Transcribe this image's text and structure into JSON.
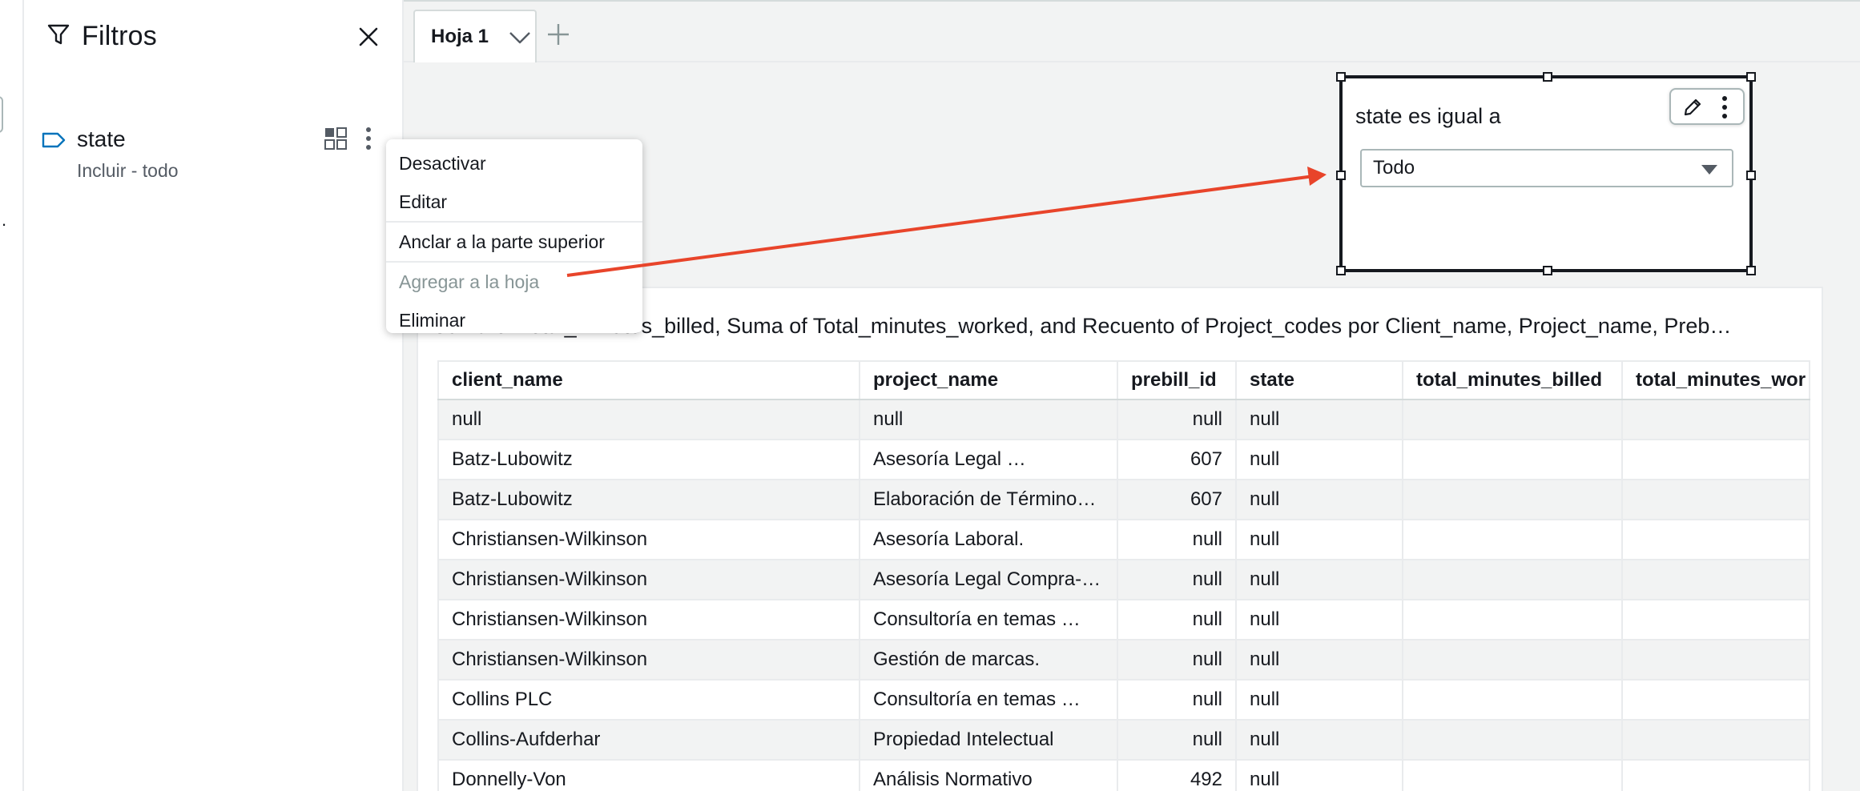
{
  "filters_panel": {
    "title": "Filtros",
    "filter": {
      "name": "state",
      "summary": "Incluir - todo"
    }
  },
  "context_menu": {
    "items": [
      {
        "label": "Desactivar",
        "enabled": true
      },
      {
        "label": "Editar",
        "enabled": true
      },
      {
        "label": "Anclar a la parte superior",
        "enabled": true
      },
      {
        "label": "Agregar a la hoja",
        "enabled": false
      },
      {
        "label": "Eliminar",
        "enabled": true
      }
    ]
  },
  "sheet_tabs": {
    "tabs": [
      {
        "label": "Hoja 1"
      }
    ]
  },
  "filter_control": {
    "label": "state es igual a",
    "selected": "Todo"
  },
  "table_visual": {
    "title": "Suma of Total_minutes_billed, Suma of Total_minutes_worked, and Recuento of Project_codes por Client_name, Project_name, Preb…",
    "columns": [
      "client_name",
      "project_name",
      "prebill_id",
      "state",
      "total_minutes_billed",
      "total_minutes_wor"
    ],
    "rows": [
      [
        "null",
        "null",
        "null",
        "null",
        "",
        ""
      ],
      [
        "Batz-Lubowitz",
        "Asesoría Legal …",
        "607",
        "null",
        "",
        ""
      ],
      [
        "Batz-Lubowitz",
        "Elaboración de Término…",
        "607",
        "null",
        "",
        ""
      ],
      [
        "Christiansen-Wilkinson",
        "Asesoría Laboral.",
        "null",
        "null",
        "",
        ""
      ],
      [
        "Christiansen-Wilkinson",
        "Asesoría Legal Compra-…",
        "null",
        "null",
        "",
        ""
      ],
      [
        "Christiansen-Wilkinson",
        "Consultoría en temas …",
        "null",
        "null",
        "",
        ""
      ],
      [
        "Christiansen-Wilkinson",
        "Gestión de marcas.",
        "null",
        "null",
        "",
        ""
      ],
      [
        "Collins PLC",
        "Consultoría en temas …",
        "null",
        "null",
        "",
        ""
      ],
      [
        "Collins-Aufderhar",
        "Propiedad Intelectual",
        "null",
        "null",
        "",
        ""
      ],
      [
        "Donnelly-Von",
        "Análisis Normativo",
        "492",
        "null",
        "",
        ""
      ]
    ]
  },
  "annotation": {
    "arrow_color": "#e8442a"
  },
  "colors": {
    "accent": "#0073bb",
    "text": "#16191f",
    "muted": "#545b64"
  }
}
